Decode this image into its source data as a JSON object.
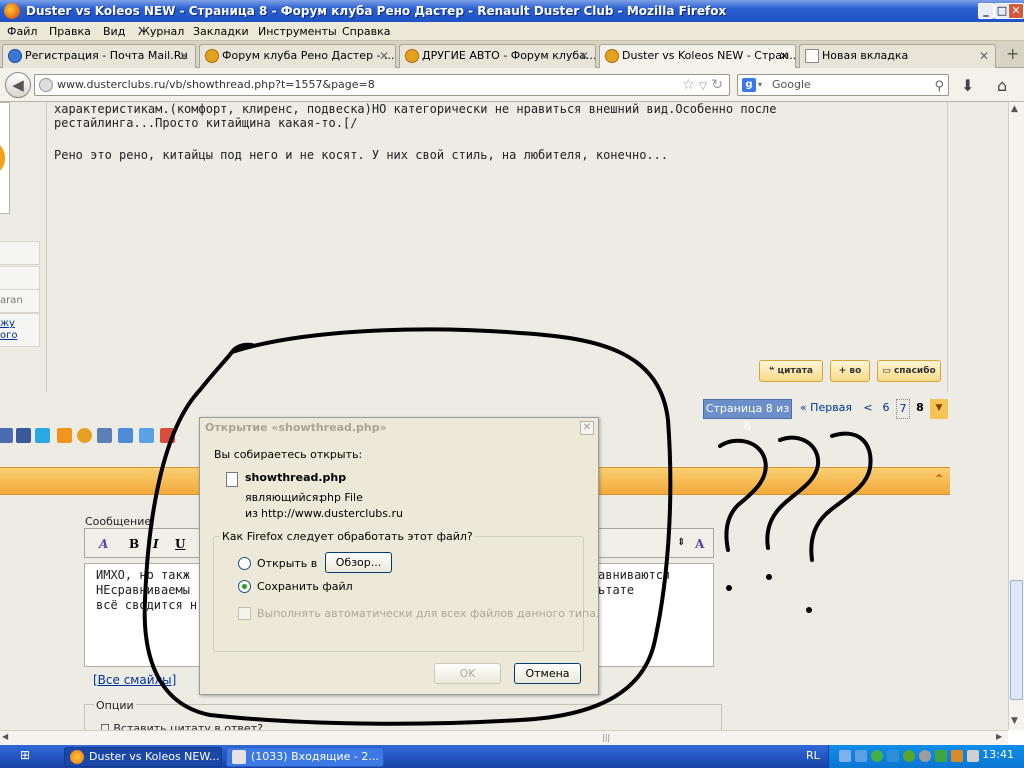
{
  "window": {
    "title": "Duster vs Koleos NEW - Страница 8 - Форум клуба Рено Дастер - Renault Duster Club - Mozilla Firefox",
    "minimize": "_",
    "maximize": "□",
    "close": "✕"
  },
  "menu": [
    "Файл",
    "Правка",
    "Вид",
    "Журнал",
    "Закладки",
    "Инструменты",
    "Справка"
  ],
  "tabs": [
    {
      "label": "Регистрация - Почта Mail.Ru",
      "icon": "mailru-icon"
    },
    {
      "label": "Форум клуба Рено Дастер - ...",
      "icon": "forum-icon"
    },
    {
      "label": "ДРУГИЕ АВТО - Форум клуба...",
      "icon": "forum-icon"
    },
    {
      "label": "Duster vs Koleos NEW - Стран...",
      "icon": "forum-icon"
    },
    {
      "label": "Новая вкладка",
      "icon": "blank-page-icon"
    }
  ],
  "tab_close": "✕",
  "new_tab": "+",
  "nav": {
    "url": "www.dusterclubs.ru/vb/showthread.php?t=1557&page=8",
    "search_placeholder": "Google",
    "search_engine_letter": "g"
  },
  "post": {
    "lines": [
      "характеристикам.(комфорт, клиренс, подвеска)НО категорически не нравиться внешний вид.Особенно после",
      "рестайлинга...Просто китайщина какая-то.[/",
      "",
      "Рено это рено, китайцы под него и не косят. У них свой стиль, на любителя, конечно..."
    ],
    "side_text": [
      "",
      "",
      "aran",
      "жу",
      "ого"
    ],
    "buttons": [
      "цитата",
      "во",
      "спасибо"
    ]
  },
  "pager": {
    "label": "Страница 8 из 8",
    "first": "« Первая",
    "prev": "<",
    "pages": [
      "6",
      "7",
      "8"
    ],
    "current": "8",
    "menu": "▼"
  },
  "reply": {
    "label": "Сообщение:",
    "toolbar": [
      "A",
      "B",
      "I",
      "U"
    ],
    "text_lines": [
      "ИМХО, но такж",
      "НЕсравниваемы",
      "всё сводится н"
    ],
    "text_right": [
      "авниваются",
      "ьтате"
    ],
    "smilies_link": "[Все смайлы]",
    "options_label": "Опции",
    "options_first": "Вставить цитату в ответ?"
  },
  "dialog": {
    "title": "Открытие «showthread.php»",
    "intro": "Вы собираетесь открыть:",
    "filename": "showthread.php",
    "type_label": "являющийся:",
    "type_value": "php File",
    "from_label": "из",
    "from_value": "http://www.dusterclubs.ru",
    "question": "Как Firefox следует обработать этот файл?",
    "open_with": "Открыть в",
    "browse": "Обзор...",
    "save_file": "Сохранить файл",
    "auto": "Выполнять автоматически для всех файлов данного типа.",
    "ok": "OK",
    "cancel": "Отмена",
    "selected": "save_file"
  },
  "taskbar": {
    "tasks": [
      "Duster vs Koleos NEW...",
      "(1033) Входящие - 2..."
    ],
    "lang": "RL",
    "clock": "13:41"
  },
  "colors": {
    "titlebar": "#2b5fd0",
    "pager_blue": "#4a6fa8",
    "orange": "#f1a93b",
    "taskbar": "#2457c4"
  }
}
